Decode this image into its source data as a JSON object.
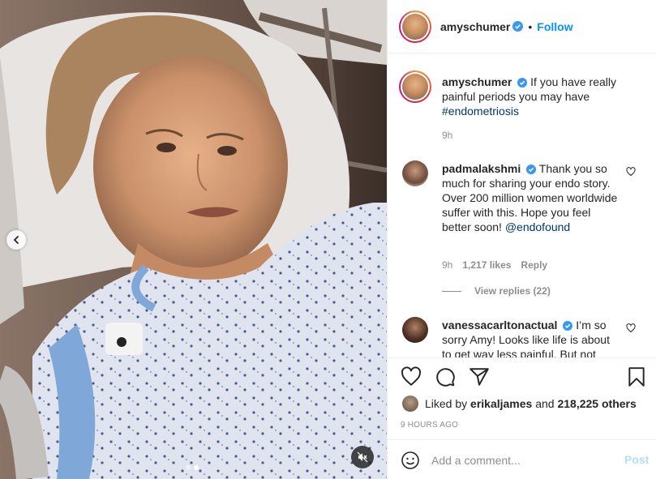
{
  "post": {
    "username": "amyschumer",
    "follow_label": "Follow",
    "dot": "•",
    "caption_text": "If you have really painful periods you may have",
    "caption_hashtag": "#endometriosis",
    "caption_time": "9h"
  },
  "comments": [
    {
      "username": "padmalakshmi",
      "text": "Thank you so much for sharing your endo story. Over 200 million women worldwide suffer with this. Hope you feel better soon!",
      "mention": "@endofound",
      "time": "9h",
      "likes": "1,217 likes",
      "reply_label": "Reply",
      "view_replies": "View replies (22)"
    },
    {
      "username": "vanessacarltonactual",
      "text": "I’m so sorry Amy! Looks like life is about to get way less painful. But not"
    }
  ],
  "likes": {
    "prefix": "Liked by",
    "user": "erikaljames",
    "and": "and",
    "others": "218,225 others"
  },
  "timestamp": "9 HOURS AGO",
  "comment_box": {
    "placeholder": "Add a comment...",
    "post_label": "Post"
  },
  "icons": {
    "verified": "verified-badge-icon",
    "heart": "heart-icon",
    "comment": "comment-icon",
    "share": "share-icon",
    "bookmark": "bookmark-icon",
    "emoji": "emoji-icon",
    "prev": "chevron-left-icon",
    "mute": "mute-icon"
  },
  "colors": {
    "accent": "#0095f6",
    "verified": "#3897f0",
    "secondary_text": "#8e8e8e",
    "link": "#00376b"
  },
  "carousel": {
    "slides": 2,
    "active": 2
  }
}
